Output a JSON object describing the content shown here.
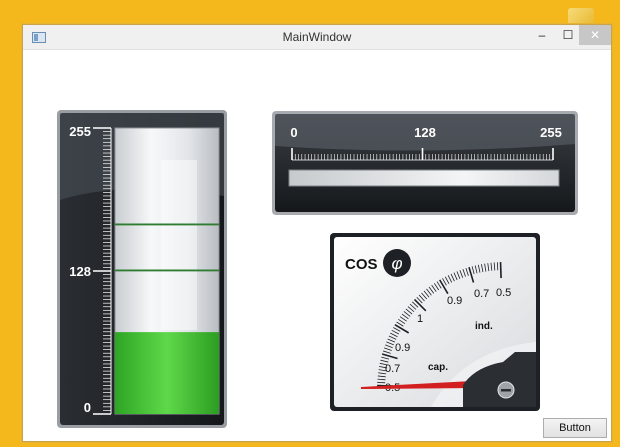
{
  "window": {
    "title": "MainWindow",
    "minimize_glyph": "–",
    "maximize_glyph": "☐",
    "close_glyph": "✕"
  },
  "vertical_gauge": {
    "scale_labels": [
      "255",
      "128",
      "0"
    ],
    "scale_min": 0,
    "scale_max": 255,
    "fill_value": 73,
    "threshold_lines": [
      128,
      169
    ],
    "fill_color": "#3bbf2e",
    "threshold_color": "#2f7d32"
  },
  "horizontal_gauge": {
    "scale_labels": [
      "0",
      "128",
      "255"
    ]
  },
  "cos_phi_meter": {
    "label_cos": "COS",
    "label_phi": "φ",
    "ind_label": "ind.",
    "cap_label": "cap.",
    "ind_scale_labels": [
      "0.9",
      "0.7",
      "0.5"
    ],
    "cap_scale_labels": [
      "1",
      "0.9",
      "0.7",
      "0.5"
    ],
    "needle_color": "#d21f1f"
  },
  "button": {
    "label": "Button"
  }
}
